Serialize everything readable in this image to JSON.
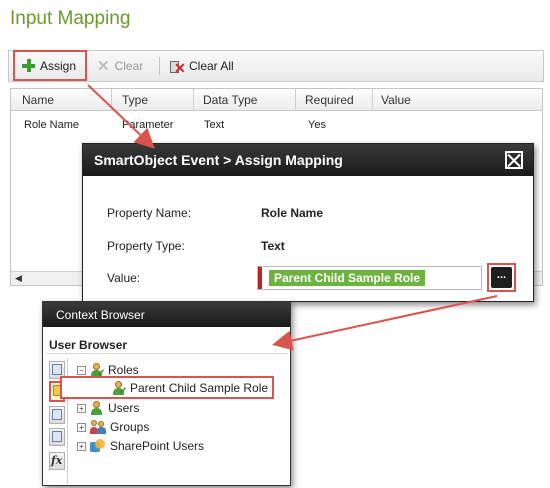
{
  "page": {
    "title": "Input Mapping"
  },
  "toolbar": {
    "assign_label": "Assign",
    "clear_label": "Clear",
    "clear_all_label": "Clear All"
  },
  "grid": {
    "columns": [
      "Name",
      "Type",
      "Data Type",
      "Required",
      "Value"
    ],
    "rows": [
      {
        "name": "Role Name",
        "type": "Parameter",
        "data_type": "Text",
        "required": "Yes",
        "value": ""
      }
    ],
    "scroll_left_glyph": "◀"
  },
  "dialog": {
    "title": "SmartObject Event > Assign Mapping",
    "property_name_label": "Property Name:",
    "property_name_value": "Role Name",
    "property_type_label": "Property Type:",
    "property_type_value": "Text",
    "value_label": "Value:",
    "value_chip": "Parent Child Sample Role",
    "ellipsis_label": "..."
  },
  "context_browser": {
    "title": "Context Browser",
    "section": "User Browser",
    "side_tabs": [
      "window-icon",
      "user-browser-icon",
      "object-icon",
      "grid-icon",
      "function-icon"
    ],
    "fx_label": "fx",
    "tree": {
      "roles": {
        "label": "Roles",
        "expander": "−"
      },
      "selected_role": {
        "label": "Parent Child Sample Role"
      },
      "users": {
        "label": "Users",
        "expander": "+"
      },
      "groups": {
        "label": "Groups",
        "expander": "+"
      },
      "sharepoint_users": {
        "label": "SharePoint Users",
        "expander": "+"
      }
    }
  },
  "colors": {
    "title_green": "#6a9a2a",
    "highlight_red": "#d9534f",
    "chip_green": "#6cb33f",
    "dark_header": "#1a1a1a"
  }
}
